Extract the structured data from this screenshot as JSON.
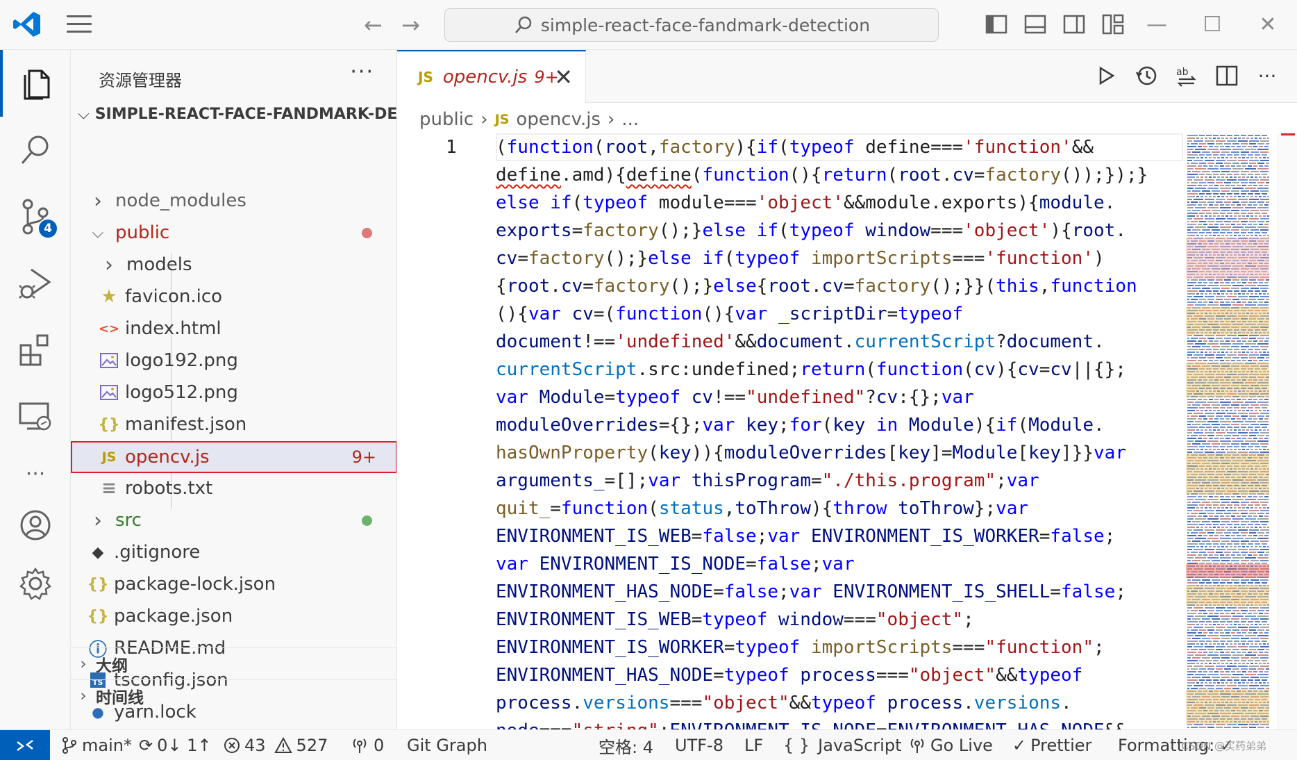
{
  "titlebar": {
    "search_text": "simple-react-face-fandmark-detection",
    "back_glyph": "←",
    "forward_glyph": "→",
    "minimize_glyph": "—",
    "maximize_glyph": "☐",
    "close_glyph": "✕"
  },
  "activity": {
    "source_control_badge": "4",
    "more_glyph": "···"
  },
  "sidebar": {
    "header": "资源管理器",
    "more": "···",
    "root_folder": "SIMPLE-REACT-FACE-FANDMARK-DE...",
    "items": [
      {
        "label": "node_modules",
        "icon": "chevron-right",
        "color": "#616161"
      },
      {
        "label": "public",
        "icon": "chevron-down",
        "color": "#b3261e",
        "dot": "#e0787a"
      },
      {
        "label": "models",
        "icon": "chevron-right",
        "color": "#3b3b3b"
      },
      {
        "label": "favicon.ico",
        "icon": "star-icon",
        "color": "#3b3b3b"
      },
      {
        "label": "index.html",
        "icon": "html-icon",
        "color": "#3b3b3b"
      },
      {
        "label": "logo192.png",
        "icon": "image-icon",
        "color": "#3b3b3b"
      },
      {
        "label": "logo512.png",
        "icon": "image-icon",
        "color": "#3b3b3b"
      },
      {
        "label": "manifest.json",
        "icon": "json-icon",
        "color": "#3b3b3b"
      },
      {
        "label": "opencv.js",
        "icon": "js-icon",
        "color": "#b3261e",
        "count": "9+"
      },
      {
        "label": "robots.txt",
        "icon": "text-icon",
        "color": "#3b3b3b"
      },
      {
        "label": "src",
        "icon": "chevron-right",
        "color": "#3a7d2e",
        "dot": "#6cb36c"
      },
      {
        "label": ".gitignore",
        "icon": "git-icon",
        "color": "#3b3b3b"
      },
      {
        "label": "package-lock.json",
        "icon": "json-icon",
        "color": "#3b3b3b"
      },
      {
        "label": "package.json",
        "icon": "json-icon",
        "color": "#3b3b3b"
      },
      {
        "label": "README.md",
        "icon": "info-icon",
        "color": "#3b3b3b"
      },
      {
        "label": "tsconfig.json",
        "icon": "ts-icon",
        "color": "#3b3b3b"
      },
      {
        "label": "yarn.lock",
        "icon": "yarn-icon",
        "color": "#3b3b3b"
      }
    ],
    "sections": [
      "大纲",
      "时间线"
    ]
  },
  "tab": {
    "badge": "JS",
    "name": "opencv.js",
    "count": "9+",
    "close": "✕"
  },
  "breadcrumb": {
    "folder": "public",
    "badge": "JS",
    "file": "opencv.js",
    "ellipsis": "..."
  },
  "editor": {
    "line_number": "1"
  },
  "statusbar": {
    "branch": "main*",
    "sync": "0↓ 1↑",
    "errors": "43",
    "warnings": "527",
    "ports": "0",
    "git_graph": "Git Graph",
    "spaces": "空格: 4",
    "encoding": "UTF-8",
    "eol": "LF",
    "language_braces": "{ }",
    "language": "JavaScript",
    "go_live": "Go Live",
    "prettier": "Prettier",
    "formatting": "Formatting: ✓",
    "watermark": "CSDN @买药弟弟"
  },
  "colors": {
    "accent": "#005fb8",
    "error": "#e11f2a",
    "modified": "#b3261e"
  }
}
